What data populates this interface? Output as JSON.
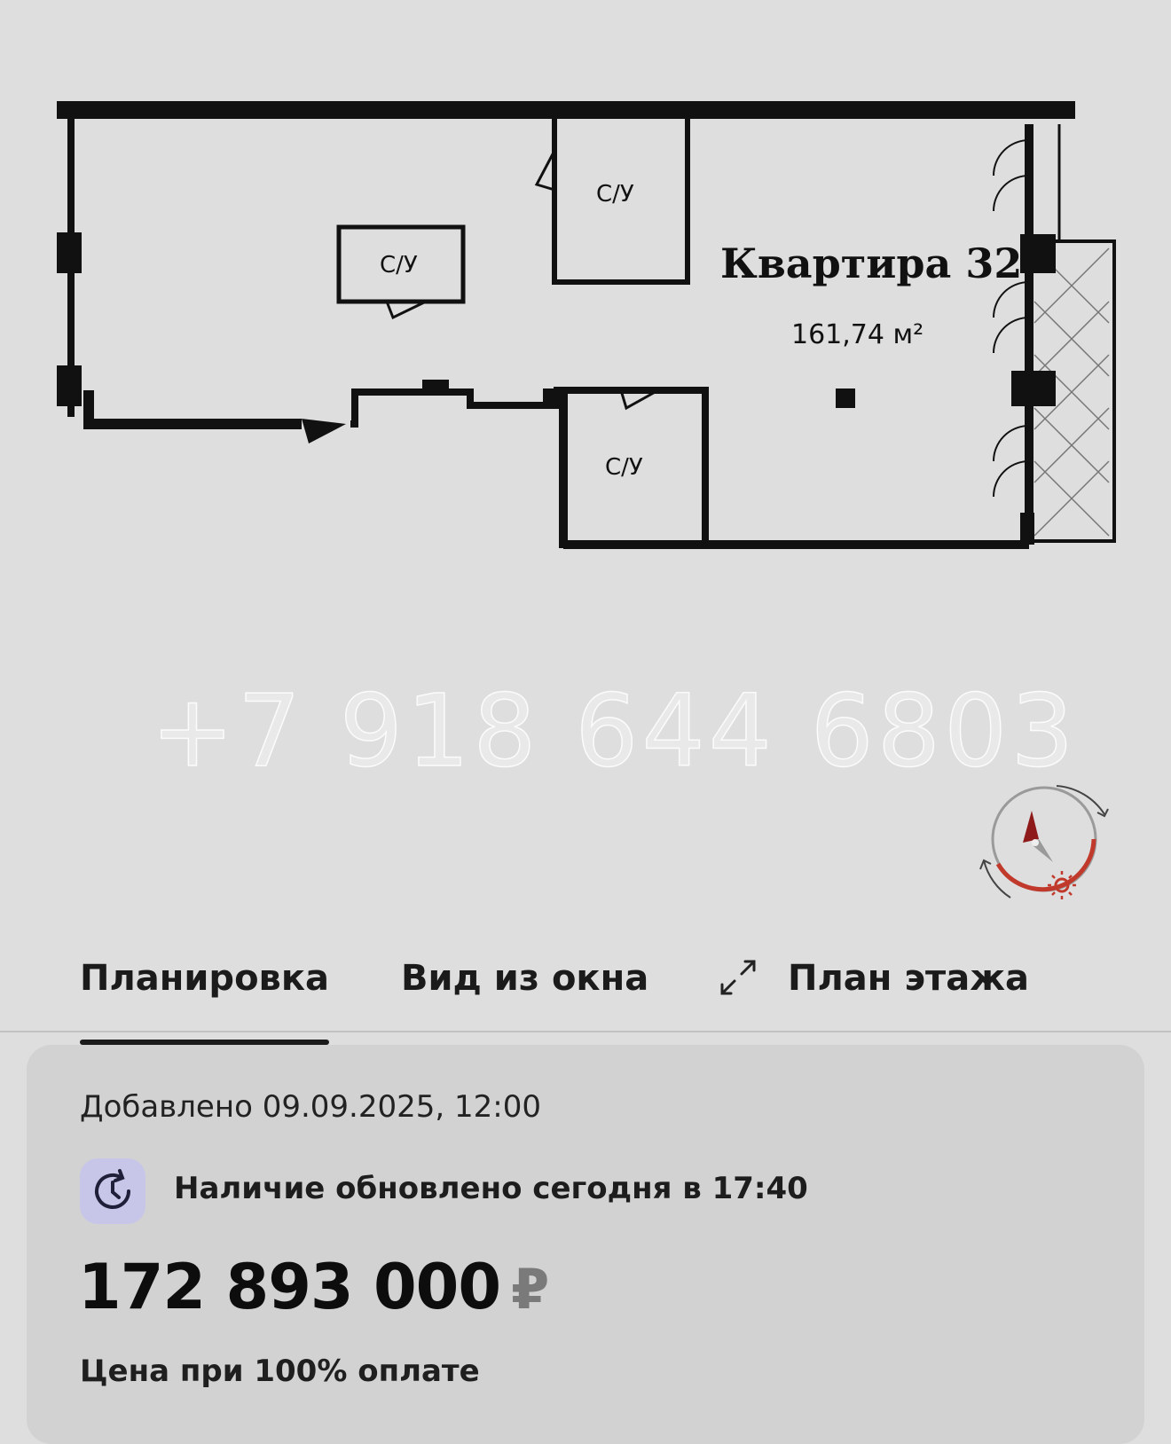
{
  "plan": {
    "title": "Квартира 32",
    "area": "161,74 м²",
    "rooms": [
      {
        "label": "С/У"
      },
      {
        "label": "С/У"
      },
      {
        "label": "С/У"
      }
    ],
    "watermark": "+7 918 644 6803"
  },
  "compass": {
    "icon": "compass-icon",
    "sun_icon": "sun-icon"
  },
  "tabs": [
    {
      "label": "Планировка",
      "active": true
    },
    {
      "label": "Вид из окна",
      "active": false
    },
    {
      "label": "План этажа",
      "active": false
    }
  ],
  "expand_icon": "expand-icon",
  "info": {
    "added": "Добавлено 09.09.2025, 12:00",
    "availability": "Наличие обновлено сегодня в 17:40",
    "availability_icon": "clock-refresh-icon",
    "price": "172 893 000",
    "currency": "₽",
    "price_note": "Цена при 100% оплате"
  },
  "colors": {
    "background": "#dedede",
    "card": "#d2d2d2",
    "compass_accent": "#c0392b",
    "icon_bg": "#c8c6e8"
  }
}
